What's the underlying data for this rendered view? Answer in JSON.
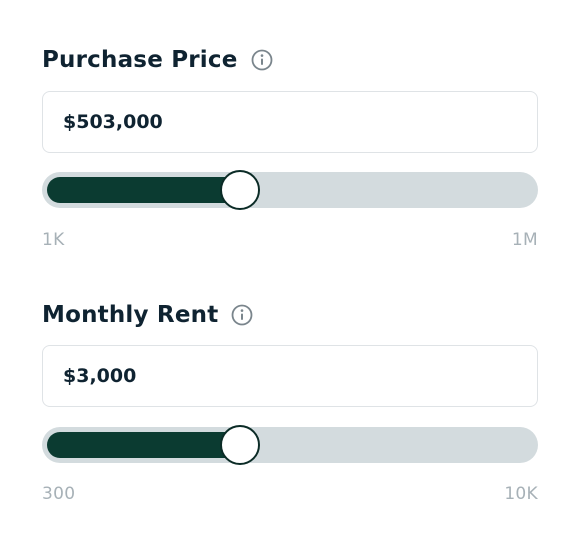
{
  "colors": {
    "text": "#0f2331",
    "track": "#d3dbde",
    "fill": "#0b3b31",
    "range_text": "#a7b1b7",
    "input_border": "#dfe3e6"
  },
  "purchase_price": {
    "label": "Purchase Price",
    "info_icon": "info-circle-icon",
    "value": "$503,000",
    "slider_fraction": 0.388,
    "min_label": "1K",
    "max_label": "1M"
  },
  "monthly_rent": {
    "label": "Monthly Rent",
    "info_icon": "info-circle-icon",
    "value": "$3,000",
    "slider_fraction": 0.388,
    "min_label": "300",
    "max_label": "10K"
  }
}
